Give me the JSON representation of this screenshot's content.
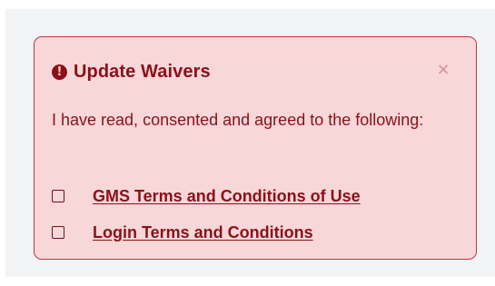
{
  "alert": {
    "icon": "exclamation-circle-icon",
    "icon_glyph": "!",
    "title": "Update Waivers",
    "close_glyph": "×",
    "message": "I have read, consented and agreed to the following:",
    "waivers": [
      {
        "label": "GMS Terms and Conditions of Use",
        "checked": false
      },
      {
        "label": "Login Terms and Conditions",
        "checked": false
      }
    ],
    "colors": {
      "background": "#f8d7d9",
      "border": "#c8323c",
      "text": "#8b1018",
      "close": "#d49094"
    }
  }
}
